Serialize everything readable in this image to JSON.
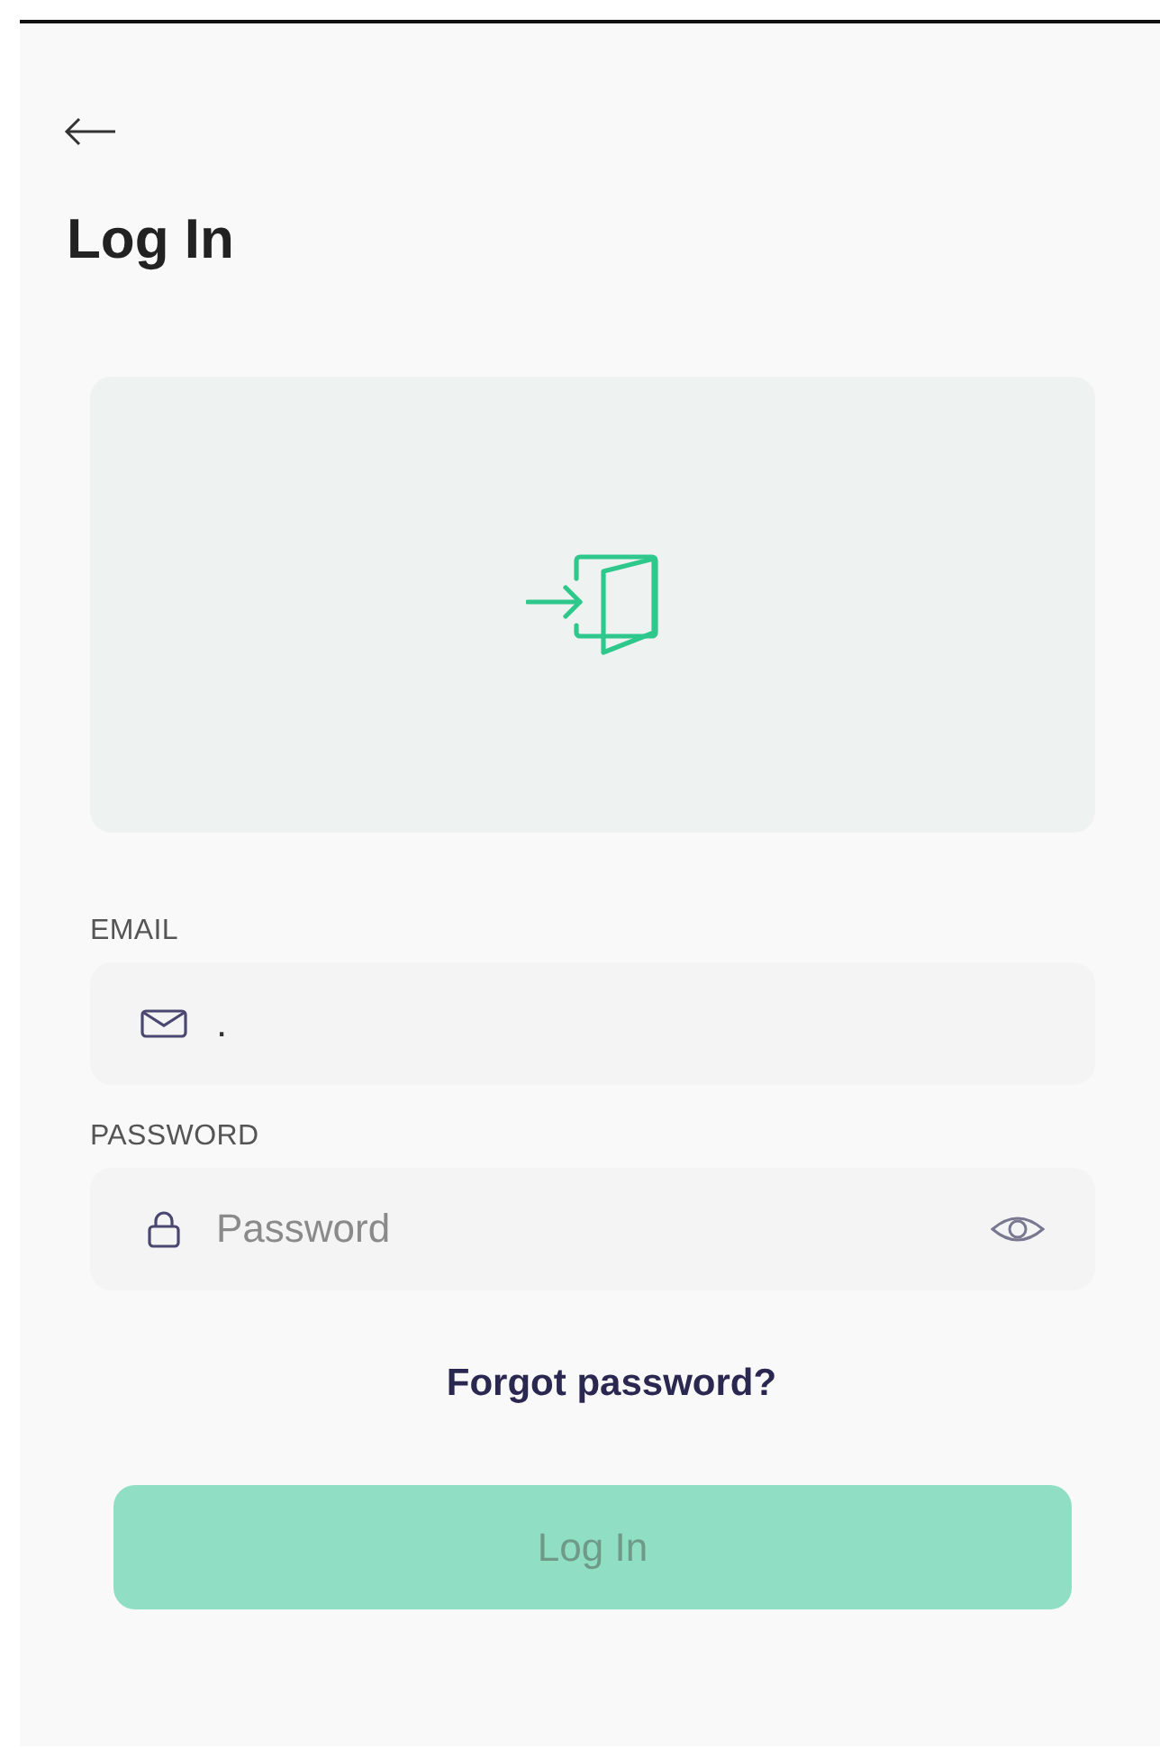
{
  "title": "Log In",
  "fields": [
    {
      "kind": "email",
      "label": "EMAIL",
      "value": "."
    },
    {
      "kind": "password",
      "label": "PASSWORD",
      "placeholder": "Password"
    }
  ],
  "forgot_link": "Forgot password?",
  "login_button": {
    "label": "Log In",
    "disabled": true
  }
}
